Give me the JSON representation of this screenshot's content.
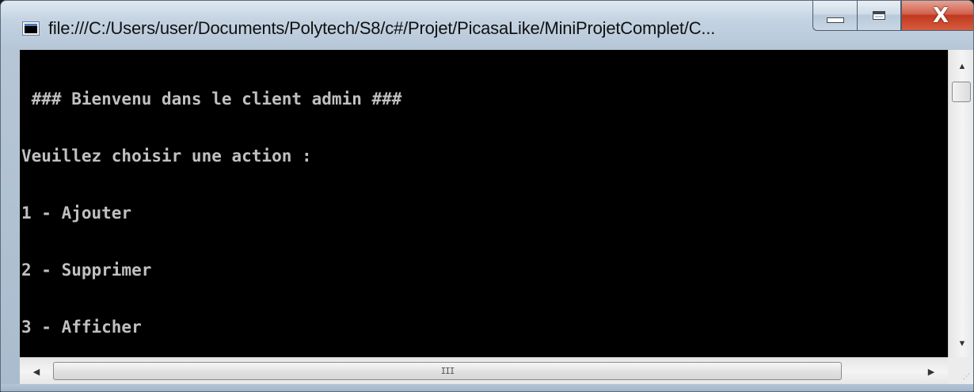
{
  "window": {
    "title": "file:///C:/Users/user/Documents/Polytech/S8/c#/Projet/PicasaLike/MiniProjetComplet/C..."
  },
  "caption_buttons": {
    "close_glyph": "X"
  },
  "console": {
    "lines": [
      " ### Bienvenu dans le client admin ###",
      "Veuillez choisir une action :",
      "1 - Ajouter",
      "2 - Supprimer",
      "3 - Afficher"
    ],
    "background_color": "#000000",
    "text_color": "#c0c0c0"
  },
  "scrollbars": {
    "up_arrow": "▲",
    "down_arrow": "▼",
    "left_arrow": "◀",
    "right_arrow": "▶",
    "thumb_grip": "III"
  },
  "icons": {
    "app": "console-window-icon",
    "minimize": "minimize-icon",
    "maximize": "maximize-icon",
    "close": "close-icon",
    "size_grip": "size-grip-icon"
  },
  "colors": {
    "close_button": "#c0391f",
    "frame": "#b6c7d8"
  }
}
